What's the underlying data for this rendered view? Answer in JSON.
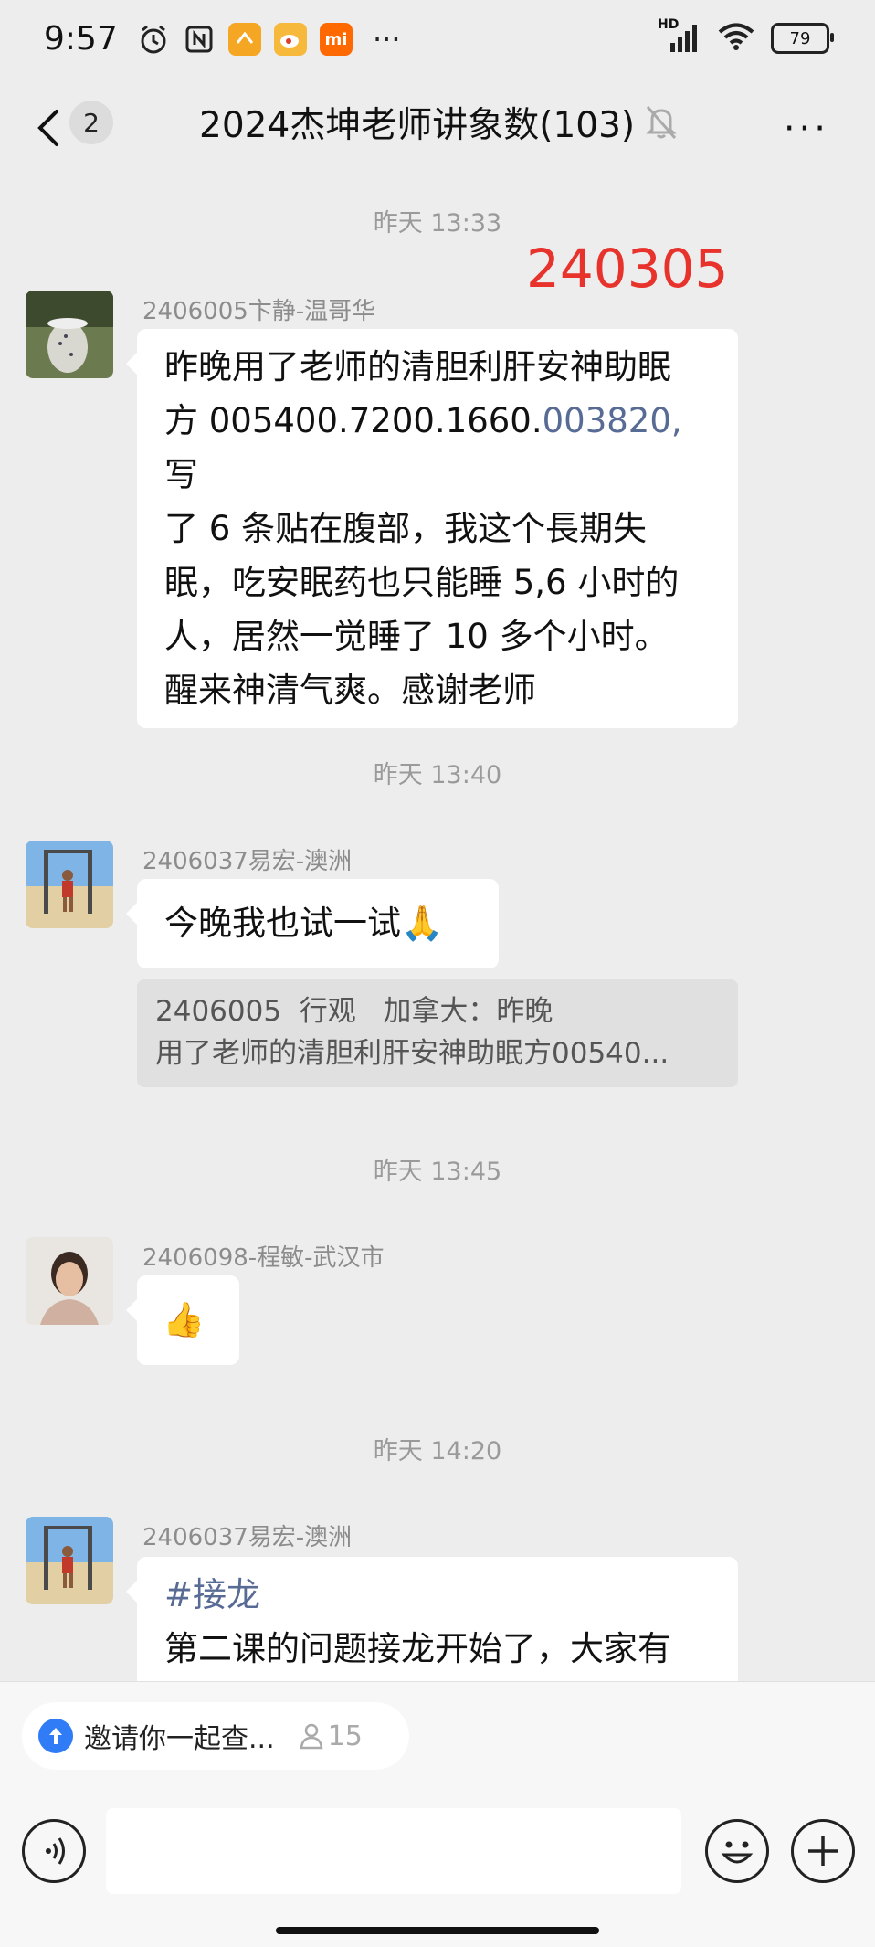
{
  "status_bar": {
    "time": "9:57",
    "battery": "79",
    "network": "HD"
  },
  "header": {
    "back_count": "2",
    "title": "2024杰坤老师讲象数(103)"
  },
  "annotation": "240305",
  "messages": [
    {
      "time": "昨天 13:33",
      "sender": "2406005卞静-温哥华",
      "lines": [
        "昨晚用了老师的清胆利肝安神助眠",
        "方 005400.7200.1660.",
        "003820,",
        "写",
        "了 6 条贴在腹部，我这个長期失",
        "眠，吃安眠药也只能睡 5,6 小时的",
        "人，居然一觉睡了 10 多个小时。",
        "醒来神清气爽。感谢老师"
      ]
    },
    {
      "time": "昨天 13:40",
      "sender": "2406037易宏-澳洲",
      "text": "今晚我也试一试",
      "emoji": "🙏",
      "quote_line1": "2406005  行观   加拿大：昨晚",
      "quote_line2": "用了老师的清胆利肝安神助眠方00540..."
    },
    {
      "time": "昨天 13:45",
      "sender": "2406098-程敏-武汉市",
      "emoji": "👍"
    },
    {
      "time": "昨天 14:20",
      "sender": "2406037易宏-澳洲",
      "tag": "#接龙",
      "text": "第二课的问题接龙开始了，大家有"
    }
  ],
  "bottom_bar": {
    "invite_text": "邀请你一起查...",
    "invite_count": "15"
  },
  "colors": {
    "background": "#ededed",
    "bubble": "#ffffff",
    "link": "#576b95",
    "red_mark": "#e8322c"
  },
  "icons": [
    "alarm-icon",
    "nfc-icon",
    "wallet-icon",
    "weibo-icon",
    "mi-icon",
    "signal-icon",
    "wifi-icon",
    "battery-icon",
    "back-icon",
    "mute-bell-icon",
    "more-icon",
    "voice-icon",
    "emoji-icon",
    "plus-icon",
    "person-icon"
  ]
}
